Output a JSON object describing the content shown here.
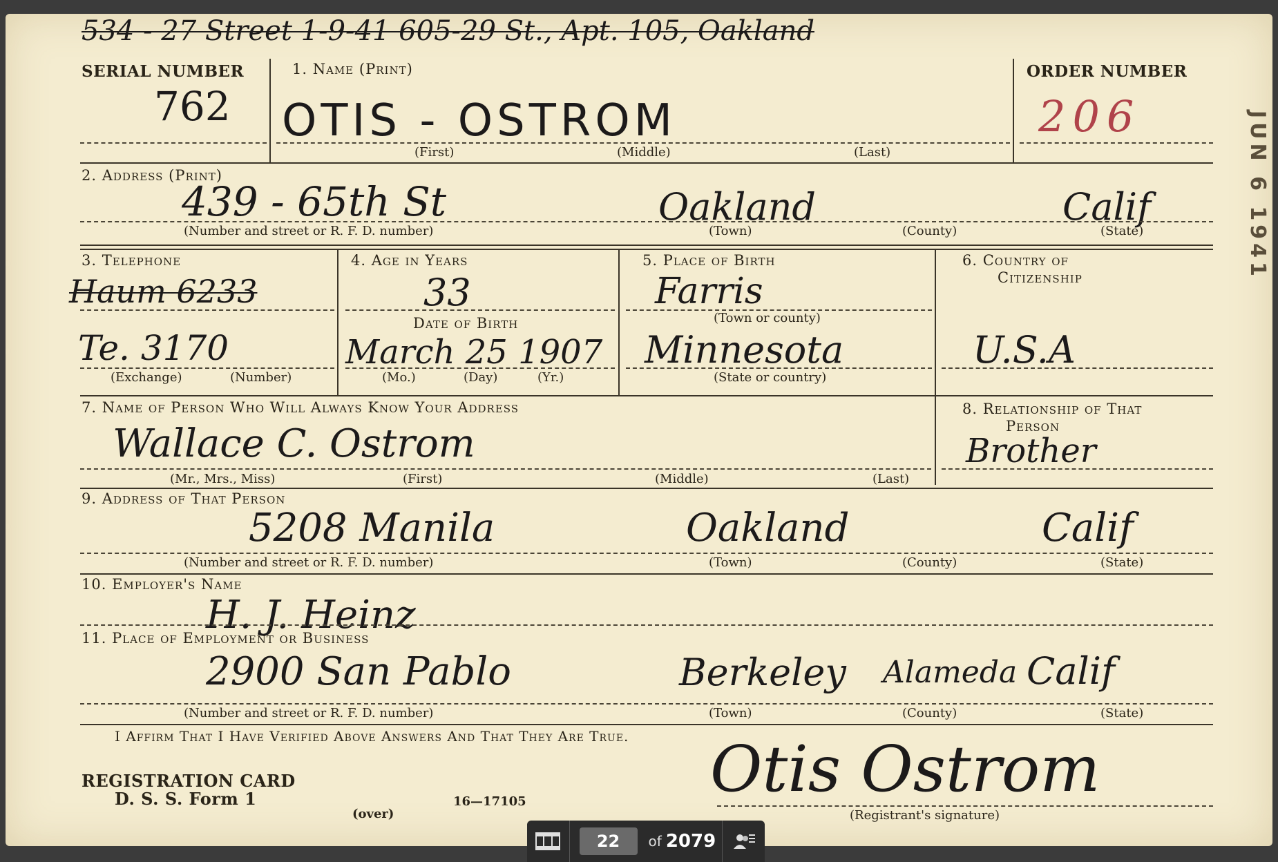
{
  "card": {
    "top_note": "534 - 27 Street 1-9-41 605-29 St., Apt. 105, Oakland",
    "serial_label": "SERIAL NUMBER",
    "serial_value": "762",
    "name_label": "1. Name (Print)",
    "name_value": "OTIS - OSTROM",
    "name_sub": {
      "first": "(First)",
      "middle": "(Middle)",
      "last": "(Last)"
    },
    "order_label": "ORDER NUMBER",
    "order_value": "206",
    "address_label": "2. Address (Print)",
    "address_street": "439 - 65th St",
    "address_town": "Oakland",
    "address_state": "Calif",
    "address_sub": {
      "street": "(Number and street or R. F. D. number)",
      "town": "(Town)",
      "county": "(County)",
      "state": "(State)"
    },
    "telephone_label": "3. Telephone",
    "telephone_old": "Haum 6233",
    "telephone_value": "Te. 3170",
    "telephone_sub": {
      "exchange": "(Exchange)",
      "number": "(Number)"
    },
    "age_label": "4. Age in Years",
    "age_value": "33",
    "dob_label": "Date of Birth",
    "dob_value": "March 25 1907",
    "dob_sub": {
      "mo": "(Mo.)",
      "day": "(Day)",
      "yr": "(Yr.)"
    },
    "birthplace_label": "5. Place of Birth",
    "birthplace_town": "Farris",
    "birthplace_town_sub": "(Town or county)",
    "birthplace_state": "Minnesota",
    "birthplace_state_sub": "(State or country)",
    "citizenship_label_1": "6. Country of",
    "citizenship_label_2": "Citizenship",
    "citizenship_value": "U.S.A",
    "contact_label": "7. Name of Person Who Will Always Know Your Address",
    "contact_value": "Wallace C. Ostrom",
    "contact_sub": {
      "title": "(Mr., Mrs., Miss)",
      "first": "(First)",
      "middle": "(Middle)",
      "last": "(Last)"
    },
    "relationship_label_1": "8. Relationship of That",
    "relationship_label_2": "Person",
    "relationship_value": "Brother",
    "contact_address_label": "9. Address of That Person",
    "contact_address_street": "5208 Manila",
    "contact_address_town": "Oakland",
    "contact_address_state": "Calif",
    "contact_address_sub": {
      "street": "(Number and street or R. F. D. number)",
      "town": "(Town)",
      "county": "(County)",
      "state": "(State)"
    },
    "employer_label": "10. Employer's Name",
    "employer_value": "H. J. Heinz",
    "employment_label": "11. Place of Employment or Business",
    "employment_street": "2900 San Pablo",
    "employment_town": "Berkeley",
    "employment_county": "Alameda",
    "employment_state": "Calif",
    "employment_sub": {
      "street": "(Number and street or R. F. D. number)",
      "town": "(Town)",
      "county": "(County)",
      "state": "(State)"
    },
    "affirm": "I Affirm That I Have Verified Above Answers And That They Are True.",
    "form_title_1": "REGISTRATION CARD",
    "form_title_2": "D. S. S. Form 1",
    "over": "(over)",
    "form_code": "16—17105",
    "signature": "Otis Ostrom",
    "signature_sub": "(Registrant's signature)",
    "stamp": "JUN 6 1941"
  },
  "viewer": {
    "current_page": "22",
    "of_label": "of",
    "total_pages": "2079"
  }
}
